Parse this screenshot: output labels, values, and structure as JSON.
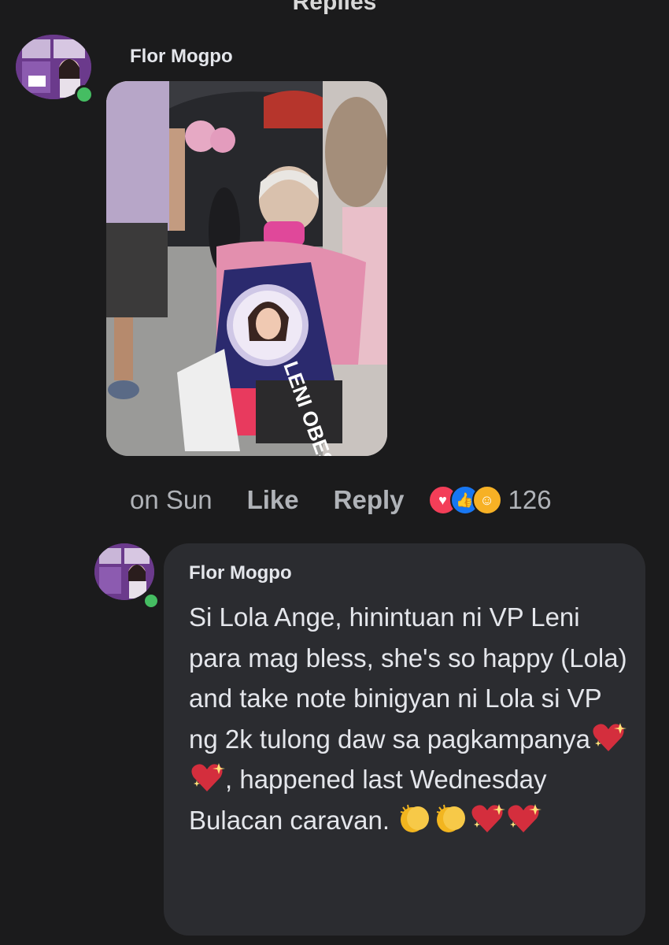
{
  "header": {
    "cut_text": "Replies"
  },
  "post": {
    "author": "Flor Mogpo",
    "photo_banner_text": "LENI OBES"
  },
  "comment_actions": {
    "time": "on Sun",
    "like": "Like",
    "reply": "Reply",
    "reaction_icons": [
      "love-reaction-icon",
      "like-reaction-icon",
      "care-reaction-icon"
    ],
    "reaction_count": "126"
  },
  "reply": {
    "author": "Flor Mogpo",
    "text_part1": "Si Lola Ange, hinintuan ni VP Leni para mag bless, she's so happy (Lola) and take note binigyan ni Lola si VP ng 2k tulong daw sa pagkampanya",
    "text_part2": ", happened last Wednesday Bulacan caravan. ",
    "emoji_after_part1": [
      "sparkling-heart-icon",
      "sparkling-heart-icon"
    ],
    "emoji_after_part2": [
      "clapping-hands-icon",
      "clapping-hands-icon",
      "sparkling-heart-icon",
      "sparkling-heart-icon"
    ]
  },
  "colors": {
    "background": "#1b1b1c",
    "bubble": "#2b2c30",
    "online": "#45bd62",
    "accent_purple": "#6b3fa0",
    "mask_pink": "#e0489a"
  }
}
